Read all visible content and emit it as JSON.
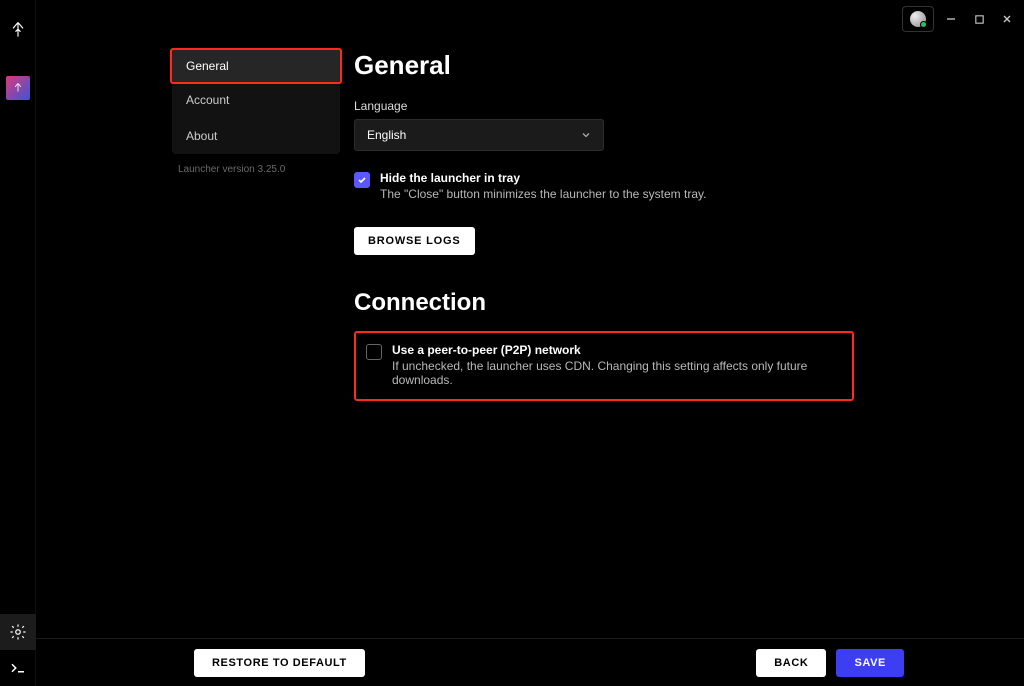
{
  "sidebar": {
    "tabs": [
      {
        "label": "General",
        "active": true
      },
      {
        "label": "Account",
        "active": false
      },
      {
        "label": "About",
        "active": false
      }
    ],
    "version_text": "Launcher version 3.25.0"
  },
  "panel": {
    "general": {
      "heading": "General",
      "language_label": "Language",
      "language_value": "English",
      "hide_tray": {
        "checked": true,
        "title": "Hide the launcher in tray",
        "desc": "The \"Close\" button minimizes the launcher to the system tray."
      },
      "browse_logs_label": "BROWSE LOGS"
    },
    "connection": {
      "heading": "Connection",
      "p2p": {
        "checked": false,
        "title": "Use a peer-to-peer (P2P) network",
        "desc": "If unchecked, the launcher uses CDN. Changing this setting affects only future downloads."
      }
    }
  },
  "footer": {
    "restore_label": "RESTORE TO DEFAULT",
    "back_label": "BACK",
    "save_label": "SAVE"
  }
}
